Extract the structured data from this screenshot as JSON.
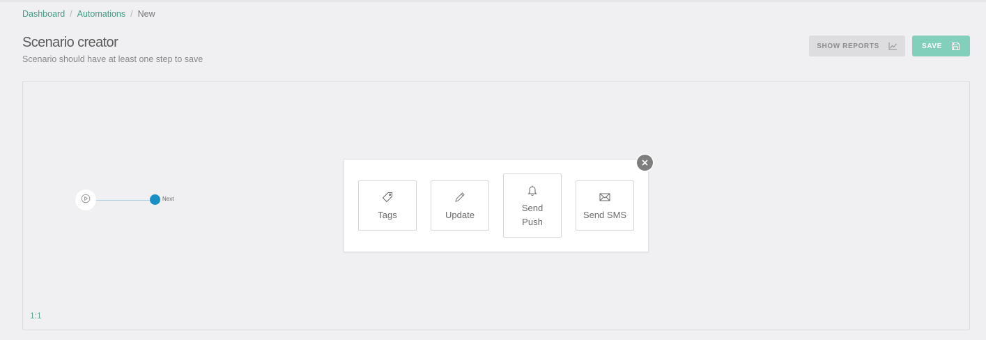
{
  "breadcrumb": {
    "items": [
      "Dashboard",
      "Automations"
    ],
    "separator": "/",
    "current": "New"
  },
  "header": {
    "title": "Scenario creator",
    "subtitle": "Scenario should have at least one step to save"
  },
  "actions": {
    "show_reports_label": "SHOW REPORTS",
    "show_reports_icon": "line-chart-icon",
    "save_label": "SAVE",
    "save_icon": "floppy-disk-icon"
  },
  "canvas": {
    "start_icon": "play-icon",
    "next_label": "Next",
    "zoom_label": "1:1"
  },
  "step_picker": {
    "close_icon": "close-icon",
    "options": [
      {
        "label": "Tags",
        "icon": "tag-icon"
      },
      {
        "label": "Update",
        "icon": "pencil-icon"
      },
      {
        "label": "Send Push",
        "icon": "bell-icon"
      },
      {
        "label": "Send SMS",
        "icon": "envelope-icon"
      }
    ]
  },
  "colors": {
    "link": "#3e9b82",
    "save_button": "#82cfbc",
    "reports_button": "#dddddf",
    "next_dot": "#1a8fc6",
    "connector": "#a9cfe6",
    "close_button": "#7e7e7e"
  }
}
